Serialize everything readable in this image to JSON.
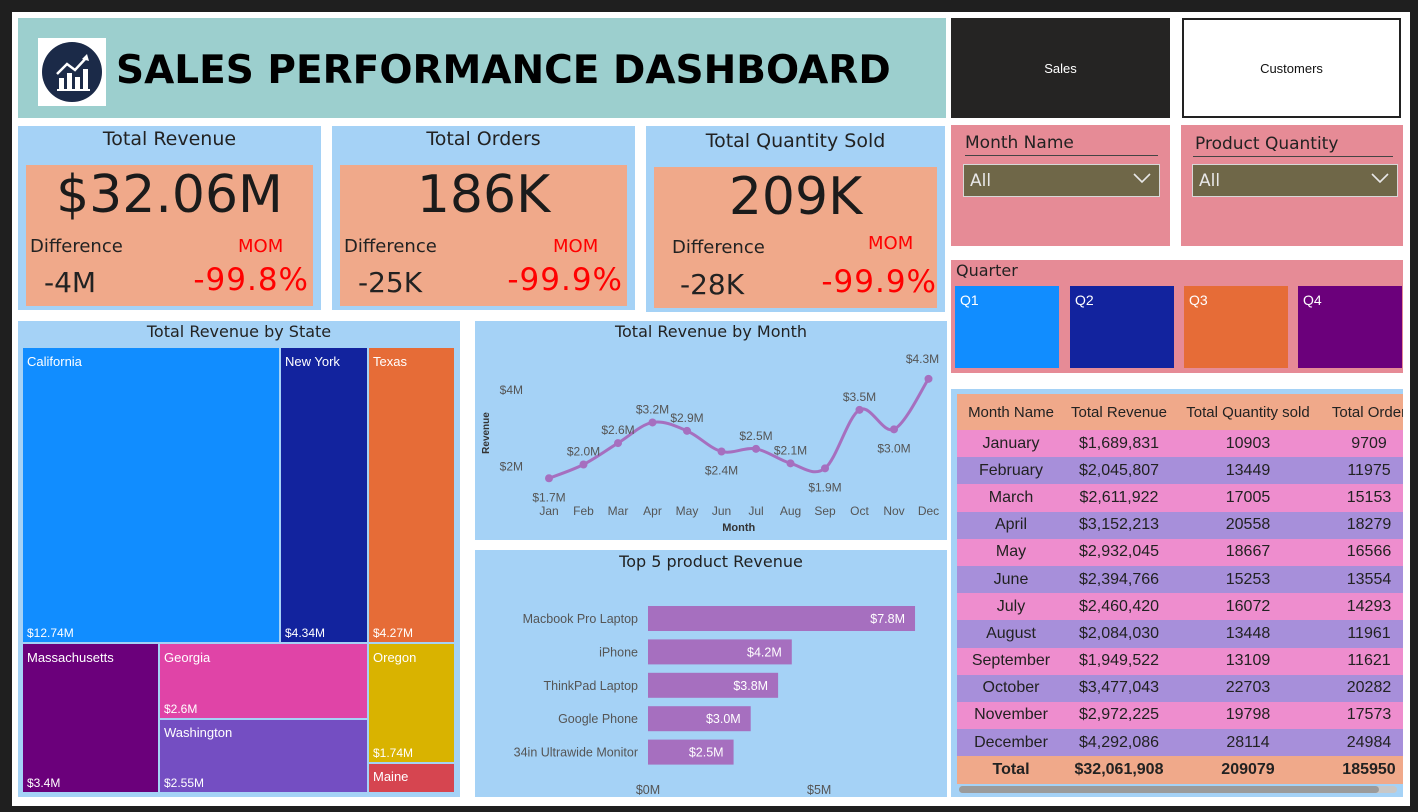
{
  "header": {
    "title": "SALES PERFORMANCE DASHBOARD",
    "logo_icon": "bar-chart-trend-icon"
  },
  "nav": {
    "sales_label": "Sales",
    "customers_label": "Customers"
  },
  "kpis": [
    {
      "title": "Total Revenue",
      "value": "$32.06M",
      "diff_label": "Difference",
      "mom_label": "MOM",
      "diff_value": "-4M",
      "mom_value": "-99.8%"
    },
    {
      "title": "Total Orders",
      "value": "186K",
      "diff_label": "Difference",
      "mom_label": "MOM",
      "diff_value": "-25K",
      "mom_value": "-99.9%"
    },
    {
      "title": "Total Quantity Sold",
      "value": "209K",
      "diff_label": "Difference",
      "mom_label": "MOM",
      "diff_value": "-28K",
      "mom_value": "-99.9%"
    }
  ],
  "slicers": {
    "month": {
      "label": "Month Name",
      "selected": "All"
    },
    "product_quantity": {
      "label": "Product Quantity",
      "selected": "All"
    },
    "quarter": {
      "label": "Quarter",
      "options": [
        "Q1",
        "Q2",
        "Q3",
        "Q4"
      ],
      "colors": [
        "#118dff",
        "#12239e",
        "#e66c37",
        "#6b007b"
      ]
    }
  },
  "chart_data": [
    {
      "type": "treemap",
      "title": "Total Revenue by State",
      "items": [
        {
          "name": "California",
          "value": "$12.74M",
          "color": "#118dff"
        },
        {
          "name": "New York",
          "value": "$4.34M",
          "color": "#12239e"
        },
        {
          "name": "Texas",
          "value": "$4.27M",
          "color": "#e66c37"
        },
        {
          "name": "Massachusetts",
          "value": "$3.4M",
          "color": "#6b007b"
        },
        {
          "name": "Georgia",
          "value": "$2.6M",
          "color": "#e044a7"
        },
        {
          "name": "Washington",
          "value": "$2.55M",
          "color": "#744ec2"
        },
        {
          "name": "Oregon",
          "value": "$1.74M",
          "color": "#d9b300"
        },
        {
          "name": "Maine",
          "value": "",
          "color": "#d64550"
        }
      ]
    },
    {
      "type": "line",
      "title": "Total Revenue by Month",
      "xlabel": "Month",
      "ylabel": "Revenue",
      "categories": [
        "Jan",
        "Feb",
        "Mar",
        "Apr",
        "May",
        "Jun",
        "Jul",
        "Aug",
        "Sep",
        "Oct",
        "Nov",
        "Dec"
      ],
      "values": [
        1.69,
        2.05,
        2.61,
        3.15,
        2.93,
        2.39,
        2.46,
        2.08,
        1.95,
        3.48,
        2.97,
        4.29
      ],
      "data_labels": [
        "$1.7M",
        "$2.0M",
        "$2.6M",
        "$3.2M",
        "$2.9M",
        "$2.4M",
        "$2.5M",
        "$2.1M",
        "$1.9M",
        "$3.5M",
        "$3.0M",
        "$4.3M"
      ],
      "y_ticks": [
        2,
        4
      ],
      "y_tick_labels": [
        "$2M",
        "$4M"
      ],
      "ylim": [
        1.2,
        4.6
      ],
      "color": "#a66fbf"
    },
    {
      "type": "bar",
      "orientation": "horizontal",
      "title": "Top 5 product Revenue",
      "categories": [
        "Macbook Pro Laptop",
        "iPhone",
        "ThinkPad Laptop",
        "Google Phone",
        "34in Ultrawide Monitor"
      ],
      "values": [
        7.8,
        4.2,
        3.8,
        3.0,
        2.5
      ],
      "data_labels": [
        "$7.8M",
        "$4.2M",
        "$3.8M",
        "$3.0M",
        "$2.5M"
      ],
      "x_ticks": [
        0,
        5
      ],
      "x_tick_labels": [
        "$0M",
        "$5M"
      ],
      "xlim": [
        0,
        8.5
      ],
      "color": "#a66fbf"
    }
  ],
  "table": {
    "columns": [
      "Month Name",
      "Total Revenue",
      "Total Quantity sold",
      "Total Order"
    ],
    "rows": [
      [
        "January",
        "$1,689,831",
        "10903",
        "9709"
      ],
      [
        "February",
        "$2,045,807",
        "13449",
        "11975"
      ],
      [
        "March",
        "$2,611,922",
        "17005",
        "15153"
      ],
      [
        "April",
        "$3,152,213",
        "20558",
        "18279"
      ],
      [
        "May",
        "$2,932,045",
        "18667",
        "16566"
      ],
      [
        "June",
        "$2,394,766",
        "15253",
        "13554"
      ],
      [
        "July",
        "$2,460,420",
        "16072",
        "14293"
      ],
      [
        "August",
        "$2,084,030",
        "13448",
        "11961"
      ],
      [
        "September",
        "$1,949,522",
        "13109",
        "11621"
      ],
      [
        "October",
        "$3,477,043",
        "22703",
        "20282"
      ],
      [
        "November",
        "$2,972,225",
        "19798",
        "17573"
      ],
      [
        "December",
        "$4,292,086",
        "28114",
        "24984"
      ]
    ],
    "total": [
      "Total",
      "$32,061,908",
      "209079",
      "185950"
    ]
  }
}
